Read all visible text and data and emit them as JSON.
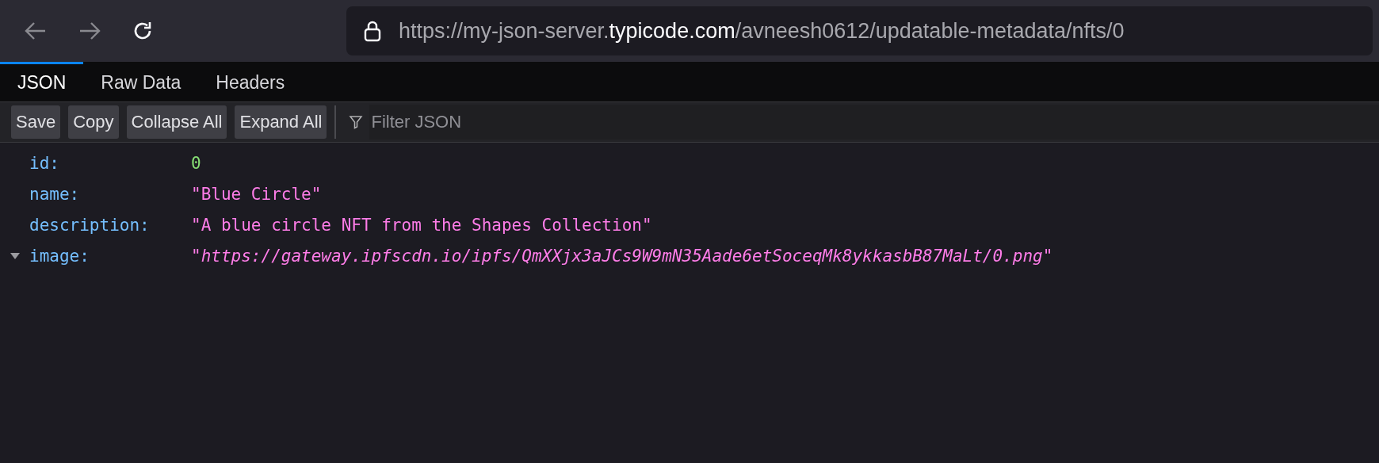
{
  "browser": {
    "url": {
      "prefix": "https://my-json-server.",
      "domain": "typicode.com",
      "suffix": "/avneesh0612/updatable-metadata/nfts/0"
    }
  },
  "tabs": [
    {
      "label": "JSON",
      "selected": true
    },
    {
      "label": "Raw Data",
      "selected": false
    },
    {
      "label": "Headers",
      "selected": false
    }
  ],
  "toolbar": {
    "buttons": [
      "Save",
      "Copy",
      "Collapse All",
      "Expand All"
    ],
    "filter": {
      "placeholder": "Filter JSON"
    }
  },
  "rows": [
    {
      "key": "id:",
      "value": "0",
      "kind": "number",
      "expanded": false
    },
    {
      "key": "name:",
      "value": "\"Blue Circle\"",
      "kind": "string",
      "expanded": false
    },
    {
      "key": "description:",
      "value": "\"A blue circle NFT from the Shapes Collection\"",
      "kind": "string",
      "expanded": false
    },
    {
      "key": "image:",
      "value": "\"*https://gateway.ipfscdn.io/ipfs/QmXXjx3aJCs9W9mN35Aade6etSoceqMk8ykkasbB87MaLt/0.png*\"",
      "kind": "string",
      "expanded": true
    }
  ]
}
